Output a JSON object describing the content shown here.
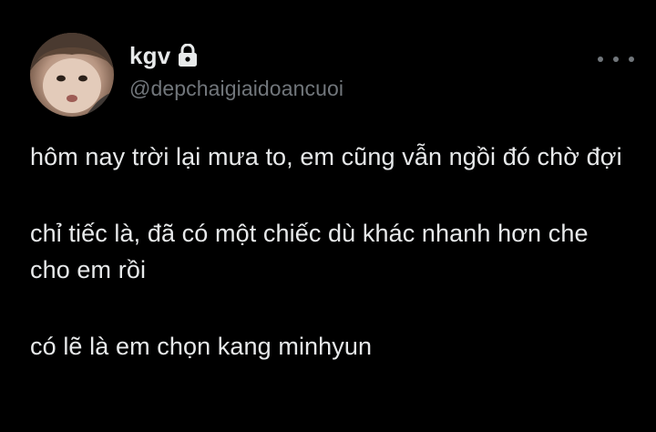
{
  "author": {
    "display_name": "kgv",
    "handle": "@depchaigiaidoancuoi",
    "verified_lock": "lock-icon",
    "avatar": "avatar"
  },
  "menu": {
    "more_icon": "more-horizontal-icon"
  },
  "tweet": {
    "paragraphs": [
      "hôm nay trời lại mưa to, em cũng vẫn ngồi đó chờ đợi",
      "chỉ tiếc là, đã có một chiếc dù khác nhanh hơn che cho em rồi",
      "có lẽ là em chọn kang minhyun"
    ]
  },
  "colors": {
    "background": "#000000",
    "primary_text": "#e7e9ea",
    "secondary_text": "#71767b"
  }
}
